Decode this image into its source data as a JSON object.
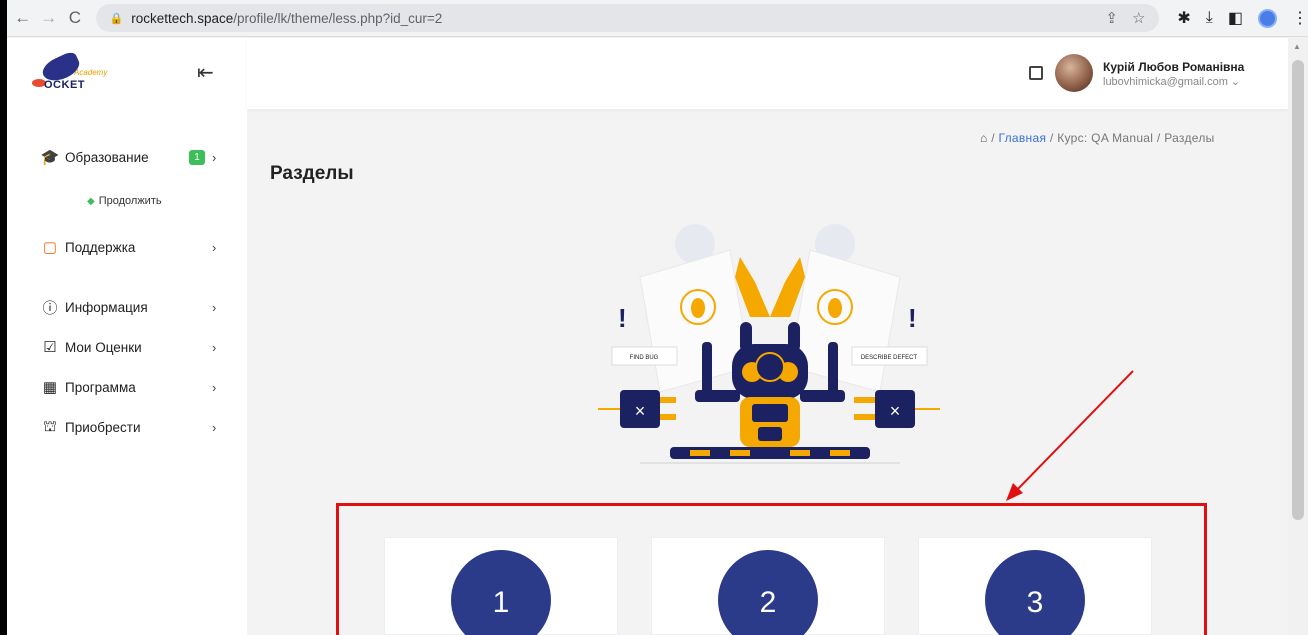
{
  "browser": {
    "url_host": "rockettech.space",
    "url_path": "/profile/lk/theme/less.php?id_cur=2"
  },
  "sidebar": {
    "logo_word": "OCKET",
    "logo_academy": "Academy",
    "items": [
      {
        "label": "Образование",
        "badge": "1"
      },
      {
        "label": "Поддержка"
      },
      {
        "label": "Информация"
      },
      {
        "label": "Мои Оценки"
      },
      {
        "label": "Программа"
      },
      {
        "label": "Приобрести"
      }
    ],
    "sub_continue": "Продолжить"
  },
  "header": {
    "user_name": "Курій Любов Романівна",
    "user_email": "lubovhimicka@gmail.com ⌄"
  },
  "breadcrumb": {
    "home": "Главная",
    "course": "Курс: QA Manual",
    "current": "Разделы",
    "sep": "/"
  },
  "main": {
    "title": "Разделы",
    "illustration_labels": {
      "left": "FIND BUG",
      "right": "DESCRIBE DEFECT"
    },
    "sections": [
      {
        "number": "1"
      },
      {
        "number": "2"
      },
      {
        "number": "3"
      }
    ]
  },
  "colors": {
    "accent": "#2c3a8a",
    "annotation": "#e01010",
    "badge": "#3cbf5a",
    "link": "#3a6fd8"
  }
}
